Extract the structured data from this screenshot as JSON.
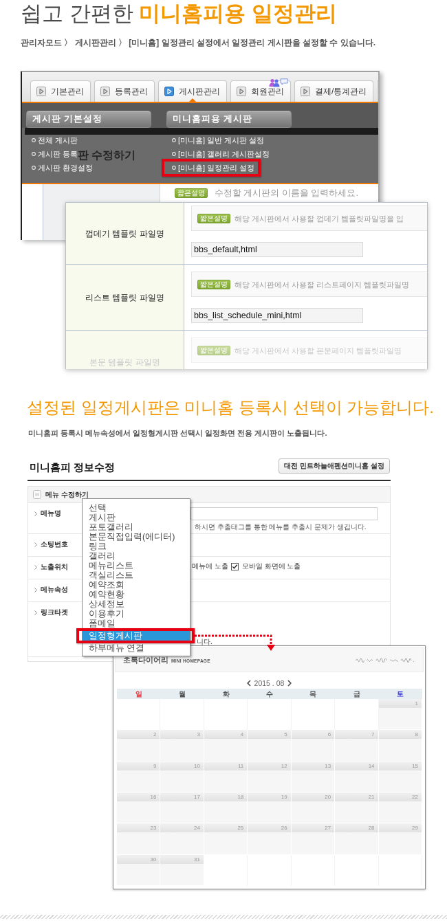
{
  "header": {
    "title": "쉽고 간편한 **미니홈피용 일정관리**",
    "subtitle": "관리자모드 〉 게시판관리 〉 [미니홈] 일정관리 설정에서 일정관리 게시판을 설정할 수 있습니다."
  },
  "admin_screenshot": {
    "tabs": [
      {
        "label": "기본관리",
        "selected": false,
        "icon_badge": false
      },
      {
        "label": "등록관리",
        "selected": false,
        "icon_badge": false
      },
      {
        "label": "게시판관리",
        "selected": true,
        "icon_badge": false
      },
      {
        "label": "회원관리",
        "selected": false,
        "icon_badge": true
      },
      {
        "label": "결제/통계관리",
        "selected": false,
        "icon_badge": false
      }
    ],
    "menu": {
      "sections": [
        {
          "heading": "게시판 기본설정",
          "items": [
            {
              "label": "전체 게시판",
              "highlighted": false
            },
            {
              "label": "게시판 등록",
              "highlighted": false
            },
            {
              "label": "게시판 환경설정",
              "highlighted": false
            }
          ]
        },
        {
          "heading": "미니홈피용 게시판",
          "items": [
            {
              "label": "[미니홈] 일반 게시판 설정",
              "highlighted": false
            },
            {
              "label": "[미니홈] 갤러리 게시판설정",
              "highlighted": false
            },
            {
              "label": "[미니홈] 일정관리 설정",
              "highlighted": true
            }
          ]
        }
      ]
    },
    "background_heading": "판 수정하기",
    "name_row": {
      "badge": "짧은설명",
      "description": "수정할 게시판의 이름을 입력하세요."
    }
  },
  "template_panel": {
    "rows": [
      {
        "label": "껍데기 템플릿 파일명",
        "badge": "짧은설명",
        "description": "해당 게시판에서 사용할 껍데기 템플릿파일명을 입",
        "value": "bbs_default,html",
        "faded": false
      },
      {
        "label": "리스트 템플릿 파일명",
        "badge": "짧은설명",
        "description": "해당 게시판에서 사용할 리스트페이지 템플릿파일명",
        "value": "bbs_list_schedule_mini,html",
        "faded": false
      },
      {
        "label": "본문 템플릿 파일명",
        "badge": "짧은설명",
        "description": "해당 게시판에서 사용할 본문페이지 템플릿파일명",
        "faded": true
      }
    ]
  },
  "section2": {
    "title": "설정된 일정게시판은 미니홈 등록시 선택이 가능합니다.",
    "subtitle": "미니홈피 등록시 메뉴속성에서 일정형게시판 선택시 일정화면 전용 게시판이 노출됩니다."
  },
  "minihome_form": {
    "title": "미니홈피 정보수정",
    "settings_button": "대전 민트하늘애펜션미니홈 설정",
    "box_title": "메뉴 수정하기",
    "rows": [
      {
        "label": "메뉴명",
        "kind": "input",
        "hint": "하시면 추출태그를 통한 메뉴를 추출시 문제가 생깁니다."
      },
      {
        "label": "소팅번호",
        "kind": "blank"
      },
      {
        "label": "노출위치",
        "kind": "checks",
        "leading_text": "메뉴에 노출",
        "option": {
          "label": "모바일 화면에 노출",
          "checked": true
        }
      },
      {
        "label": "메뉴속성",
        "kind": "blank"
      },
      {
        "label": "링크타겟",
        "kind": "note",
        "note": "니다."
      }
    ]
  },
  "menu_type_dropdown": {
    "options": [
      {
        "label": "선택",
        "selected": false,
        "highlighted": false
      },
      {
        "label": "게시판",
        "selected": false,
        "highlighted": false
      },
      {
        "label": "포토갤러리",
        "selected": false,
        "highlighted": false
      },
      {
        "label": "본문직접입력(에디터)",
        "selected": false,
        "highlighted": false
      },
      {
        "label": "링크",
        "selected": false,
        "highlighted": false
      },
      {
        "label": "갤러리",
        "selected": false,
        "highlighted": false
      },
      {
        "label": "메뉴리스트",
        "selected": false,
        "highlighted": false
      },
      {
        "label": "객실리스트",
        "selected": false,
        "highlighted": false
      },
      {
        "label": "예약조회",
        "selected": false,
        "highlighted": false
      },
      {
        "label": "예약현황",
        "selected": false,
        "highlighted": false
      },
      {
        "label": "상세정보",
        "selected": false,
        "highlighted": false
      },
      {
        "label": "이용후기",
        "selected": false,
        "highlighted": false
      },
      {
        "label": "폼메일",
        "selected": false,
        "highlighted": false
      },
      {
        "label": "일정형게시판",
        "selected": true,
        "highlighted": true
      },
      {
        "label": "하부메뉴 연결",
        "selected": false,
        "highlighted": false
      }
    ]
  },
  "calendar": {
    "brand": "초록다이어리",
    "brand_sub": "MINI HOMEPAGE",
    "month": "2015 . 08",
    "weekdays": [
      {
        "label": "일",
        "color": "#e8383d"
      },
      {
        "label": "월",
        "color": "#555555"
      },
      {
        "label": "화",
        "color": "#555555"
      },
      {
        "label": "수",
        "color": "#555555"
      },
      {
        "label": "목",
        "color": "#555555"
      },
      {
        "label": "금",
        "color": "#555555"
      },
      {
        "label": "토",
        "color": "#3a3ae0"
      }
    ],
    "weeks": [
      {
        "days": [
          {
            "kind": "blank"
          },
          {
            "kind": "blank"
          },
          {
            "kind": "blank"
          },
          {
            "kind": "blank"
          },
          {
            "kind": "blank"
          },
          {
            "kind": "blank"
          },
          {
            "kind": "day",
            "day": "1"
          }
        ]
      },
      {
        "days": [
          {
            "kind": "day",
            "day": "2"
          },
          {
            "kind": "day",
            "day": "3"
          },
          {
            "kind": "day",
            "day": "4"
          },
          {
            "kind": "day",
            "day": "5"
          },
          {
            "kind": "day",
            "day": "6"
          },
          {
            "kind": "day",
            "day": "7"
          },
          {
            "kind": "day",
            "day": "8"
          }
        ]
      },
      {
        "days": [
          {
            "kind": "day",
            "day": "9"
          },
          {
            "kind": "day",
            "day": "10"
          },
          {
            "kind": "day",
            "day": "11"
          },
          {
            "kind": "day",
            "day": "12"
          },
          {
            "kind": "day",
            "day": "13"
          },
          {
            "kind": "day",
            "day": "14"
          },
          {
            "kind": "day",
            "day": "15"
          }
        ]
      },
      {
        "days": [
          {
            "kind": "day",
            "day": "16"
          },
          {
            "kind": "day",
            "day": "17"
          },
          {
            "kind": "day",
            "day": "18"
          },
          {
            "kind": "day",
            "day": "19"
          },
          {
            "kind": "day",
            "day": "20"
          },
          {
            "kind": "day",
            "day": "21"
          },
          {
            "kind": "day",
            "day": "22"
          }
        ]
      },
      {
        "days": [
          {
            "kind": "day",
            "day": "23"
          },
          {
            "kind": "day",
            "day": "24"
          },
          {
            "kind": "day",
            "day": "25"
          },
          {
            "kind": "day",
            "day": "26"
          },
          {
            "kind": "day",
            "day": "27"
          },
          {
            "kind": "day",
            "day": "28"
          },
          {
            "kind": "day",
            "day": "29"
          }
        ]
      },
      {
        "days": [
          {
            "kind": "day",
            "day": "30"
          },
          {
            "kind": "day",
            "day": "31"
          },
          {
            "kind": "blank"
          },
          {
            "kind": "blank"
          },
          {
            "kind": "blank"
          },
          {
            "kind": "blank"
          },
          {
            "kind": "blank"
          }
        ]
      }
    ]
  }
}
